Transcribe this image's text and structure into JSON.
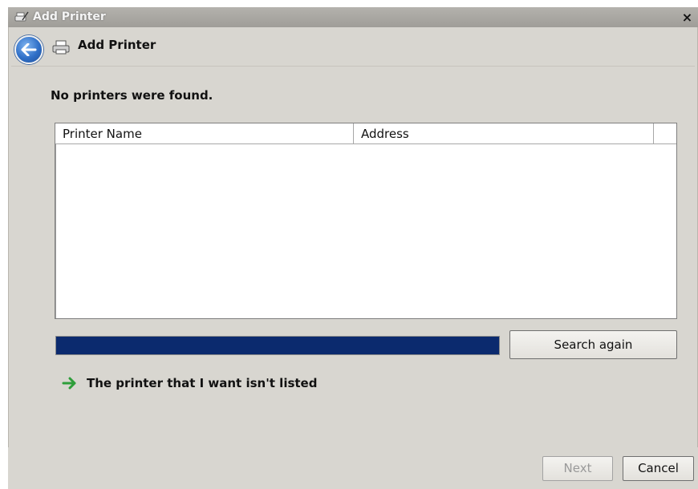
{
  "window": {
    "title": "Add Printer",
    "close_glyph": "×"
  },
  "header": {
    "title": "Add Printer"
  },
  "main": {
    "status": "No printers were found.",
    "list": {
      "columns": [
        "Printer Name",
        "Address"
      ],
      "rows": []
    },
    "progress": {
      "fraction": 1.0
    },
    "search_again_label": "Search again",
    "link_label": "The printer that I want isn't listed"
  },
  "footer": {
    "next_label": "Next",
    "cancel_label": "Cancel"
  },
  "colors": {
    "progress": "#0b2a6e",
    "window_bg": "#d8d6d0",
    "link_arrow": "#2e9e3a"
  },
  "icons": {
    "title": "printer-wand-icon",
    "back": "back-arrow-icon",
    "header": "printer-icon",
    "link": "green-arrow-icon"
  }
}
